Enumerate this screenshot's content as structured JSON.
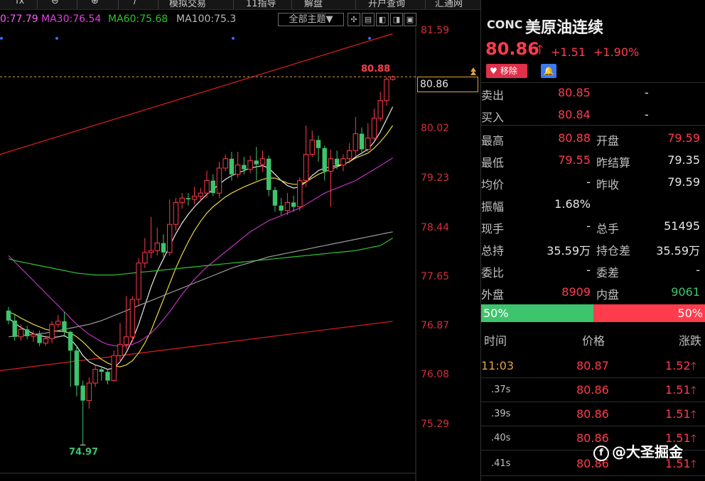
{
  "toolbar": {
    "items": [
      "fx",
      "⊖",
      "⊕",
      "/",
      "模拟交易",
      "11指导",
      "解盘",
      "开户查询",
      "汇通网"
    ]
  },
  "ma_legend": [
    {
      "label": "0:77.79",
      "color": "#ff5cff"
    },
    {
      "label": "MA30:76.54",
      "color": "#e040e0"
    },
    {
      "label": "MA60:75.68",
      "color": "#2fc22f"
    },
    {
      "label": "MA100:75.3",
      "color": "#b8b8b8"
    }
  ],
  "topic_button": "全部主题▼",
  "y_ticks": [
    "81.59",
    "80.02",
    "79.23",
    "78.44",
    "77.65",
    "76.87",
    "76.08",
    "75.29"
  ],
  "high_label": "80.88",
  "low_label": "74.97",
  "current_price_box": "80.86",
  "colors": {
    "up": "#ff3c4c",
    "down": "#3ec46d",
    "bg": "#000000",
    "accent": "#e1a43c"
  },
  "chart_data": {
    "type": "candlestick",
    "title": "",
    "ylim": [
      74.8,
      81.9
    ],
    "y_ticks": [
      81.59,
      80.02,
      79.23,
      78.44,
      77.65,
      76.87,
      76.08,
      75.29
    ],
    "current_price": 80.86,
    "high": 80.88,
    "low": 74.97,
    "candles": [
      [
        77.12,
        76.96,
        77.18,
        76.9
      ],
      [
        76.96,
        76.7,
        77.05,
        76.64
      ],
      [
        76.7,
        76.82,
        76.9,
        76.64
      ],
      [
        76.82,
        76.71,
        76.88,
        76.66
      ],
      [
        76.71,
        76.74,
        76.8,
        76.62
      ],
      [
        76.74,
        76.6,
        76.8,
        76.55
      ],
      [
        76.6,
        76.67,
        76.72,
        76.56
      ],
      [
        76.67,
        76.9,
        76.95,
        76.6
      ],
      [
        76.9,
        76.95,
        77.05,
        76.85
      ],
      [
        76.95,
        76.78,
        77.1,
        76.7
      ],
      [
        76.78,
        76.48,
        76.8,
        75.9
      ],
      [
        76.48,
        75.92,
        76.55,
        75.75
      ],
      [
        75.92,
        75.68,
        76.0,
        74.97
      ],
      [
        75.68,
        75.96,
        76.05,
        75.55
      ],
      [
        75.96,
        76.18,
        76.25,
        75.9
      ],
      [
        76.18,
        76.14,
        76.22,
        76.0
      ],
      [
        76.14,
        76.0,
        76.18,
        75.94
      ],
      [
        76.0,
        76.4,
        76.48,
        75.98
      ],
      [
        76.4,
        76.58,
        76.92,
        76.3
      ],
      [
        76.58,
        76.7,
        77.35,
        76.5
      ],
      [
        76.7,
        77.3,
        77.35,
        76.62
      ],
      [
        77.3,
        77.88,
        77.96,
        77.2
      ],
      [
        77.88,
        78.05,
        78.28,
        77.8
      ],
      [
        78.05,
        78.08,
        78.62,
        77.96
      ],
      [
        78.08,
        78.2,
        78.45,
        78.0
      ],
      [
        78.2,
        78.05,
        78.34,
        77.98
      ],
      [
        78.05,
        78.5,
        78.9,
        78.0
      ],
      [
        78.5,
        78.85,
        78.92,
        78.4
      ],
      [
        78.85,
        78.92,
        79.0,
        78.75
      ],
      [
        78.92,
        78.9,
        79.0,
        78.8
      ],
      [
        78.9,
        78.95,
        79.1,
        78.82
      ],
      [
        78.95,
        79.0,
        79.08,
        78.88
      ],
      [
        79.0,
        79.2,
        79.36,
        78.92
      ],
      [
        79.2,
        79.0,
        79.3,
        78.95
      ],
      [
        79.0,
        79.4,
        79.5,
        78.92
      ],
      [
        79.4,
        79.55,
        79.62,
        79.35
      ],
      [
        79.55,
        79.3,
        79.66,
        79.2
      ],
      [
        79.3,
        79.45,
        79.66,
        79.25
      ],
      [
        79.45,
        79.38,
        79.58,
        79.3
      ],
      [
        79.38,
        79.52,
        79.6,
        79.32
      ],
      [
        79.52,
        79.46,
        79.74,
        79.2
      ],
      [
        79.46,
        79.55,
        79.68,
        79.34
      ],
      [
        79.55,
        79.05,
        79.6,
        78.95
      ],
      [
        79.05,
        78.8,
        79.1,
        78.7
      ],
      [
        78.8,
        78.72,
        78.92,
        78.65
      ],
      [
        78.72,
        78.85,
        79.0,
        78.65
      ],
      [
        78.85,
        78.78,
        78.96,
        78.7
      ],
      [
        78.78,
        79.2,
        79.25,
        78.72
      ],
      [
        79.2,
        79.62,
        80.08,
        79.1
      ],
      [
        79.62,
        79.85,
        80.0,
        79.58
      ],
      [
        79.85,
        79.72,
        79.92,
        79.5
      ],
      [
        79.72,
        79.35,
        79.76,
        79.2
      ],
      [
        79.35,
        79.55,
        79.7,
        78.78
      ],
      [
        79.55,
        79.45,
        79.68,
        79.38
      ],
      [
        79.45,
        79.55,
        79.62,
        79.35
      ],
      [
        79.55,
        79.68,
        79.8,
        79.48
      ],
      [
        79.68,
        79.95,
        80.22,
        79.6
      ],
      [
        79.95,
        79.7,
        80.05,
        79.62
      ],
      [
        79.7,
        79.88,
        80.12,
        79.66
      ],
      [
        79.88,
        80.2,
        80.35,
        79.85
      ],
      [
        80.2,
        80.48,
        80.62,
        80.15
      ],
      [
        80.48,
        80.82,
        80.86,
        80.4
      ],
      [
        80.82,
        80.86,
        80.88,
        80.8
      ]
    ],
    "overlays": [
      {
        "name": "channel-upper",
        "color": "#e02020",
        "points": [
          [
            -2,
            79.6
          ],
          [
            62,
            81.55
          ]
        ]
      },
      {
        "name": "channel-lower",
        "color": "#e02020",
        "points": [
          [
            -2,
            76.15
          ],
          [
            62,
            76.95
          ]
        ]
      },
      {
        "name": "ma-white",
        "color": "#e8e8e8",
        "values": [
          77.0,
          76.92,
          76.85,
          76.8,
          76.75,
          76.72,
          76.7,
          76.69,
          76.7,
          76.72,
          76.66,
          76.55,
          76.4,
          76.3,
          76.25,
          76.22,
          76.18,
          76.2,
          76.3,
          76.45,
          76.65,
          76.9,
          77.2,
          77.5,
          77.75,
          77.95,
          78.15,
          78.35,
          78.52,
          78.66,
          78.78,
          78.88,
          78.98,
          79.06,
          79.14,
          79.22,
          79.28,
          79.32,
          79.36,
          79.4,
          79.42,
          79.44,
          79.4,
          79.3,
          79.2,
          79.12,
          79.08,
          79.1,
          79.18,
          79.28,
          79.36,
          79.4,
          79.42,
          79.44,
          79.46,
          79.5,
          79.58,
          79.64,
          79.7,
          79.82,
          79.98,
          80.18,
          80.38
        ]
      },
      {
        "name": "ma-yellow",
        "color": "#e8d83a",
        "values": [
          77.1,
          77.06,
          77.0,
          76.95,
          76.9,
          76.86,
          76.82,
          76.8,
          76.79,
          76.78,
          76.76,
          76.7,
          76.62,
          76.52,
          76.42,
          76.34,
          76.28,
          76.24,
          76.22,
          76.25,
          76.32,
          76.44,
          76.6,
          76.8,
          77.05,
          77.3,
          77.55,
          77.8,
          78.02,
          78.22,
          78.4,
          78.55,
          78.68,
          78.78,
          78.86,
          78.94,
          79.0,
          79.05,
          79.1,
          79.14,
          79.18,
          79.22,
          79.24,
          79.24,
          79.2,
          79.16,
          79.14,
          79.14,
          79.18,
          79.24,
          79.3,
          79.34,
          79.38,
          79.42,
          79.46,
          79.5,
          79.56,
          79.6,
          79.64,
          79.72,
          79.82,
          79.94,
          80.08
        ]
      },
      {
        "name": "ma30",
        "color": "#c030c0",
        "values": [
          78.0,
          77.9,
          77.8,
          77.7,
          77.6,
          77.5,
          77.4,
          77.3,
          77.2,
          77.1,
          77.0,
          76.9,
          76.82,
          76.74,
          76.68,
          76.62,
          76.58,
          76.56,
          76.55,
          76.56,
          76.58,
          76.62,
          76.68,
          76.76,
          76.86,
          76.98,
          77.1,
          77.24,
          77.38,
          77.5,
          77.62,
          77.72,
          77.82,
          77.9,
          77.98,
          78.06,
          78.14,
          78.22,
          78.3,
          78.38,
          78.44,
          78.5,
          78.56,
          78.6,
          78.64,
          78.68,
          78.72,
          78.76,
          78.82,
          78.88,
          78.94,
          79.0,
          79.04,
          79.08,
          79.12,
          79.16,
          79.2,
          79.26,
          79.32,
          79.38,
          79.44,
          79.5,
          79.56
        ]
      },
      {
        "name": "ma60",
        "color": "#2fc22f",
        "values": [
          77.95,
          77.92,
          77.9,
          77.88,
          77.86,
          77.84,
          77.82,
          77.8,
          77.78,
          77.76,
          77.74,
          77.72,
          77.71,
          77.7,
          77.69,
          77.69,
          77.69,
          77.69,
          77.7,
          77.71,
          77.72,
          77.73,
          77.74,
          77.75,
          77.76,
          77.77,
          77.78,
          77.79,
          77.8,
          77.81,
          77.82,
          77.83,
          77.84,
          77.85,
          77.86,
          77.87,
          77.88,
          77.89,
          77.9,
          77.91,
          77.92,
          77.93,
          77.94,
          77.95,
          77.96,
          77.97,
          77.98,
          77.99,
          78.0,
          78.01,
          78.02,
          78.03,
          78.04,
          78.05,
          78.06,
          78.07,
          78.08,
          78.1,
          78.12,
          78.14,
          78.16,
          78.22,
          78.28
        ]
      },
      {
        "name": "ma100",
        "color": "#9a9a9a",
        "values": [
          76.7,
          76.71,
          76.72,
          76.73,
          76.74,
          76.75,
          76.76,
          76.78,
          76.8,
          76.82,
          76.84,
          76.86,
          76.88,
          76.9,
          76.93,
          76.96,
          77.0,
          77.04,
          77.08,
          77.12,
          77.16,
          77.2,
          77.24,
          77.28,
          77.32,
          77.36,
          77.4,
          77.44,
          77.48,
          77.52,
          77.56,
          77.6,
          77.64,
          77.68,
          77.72,
          77.76,
          77.8,
          77.83,
          77.86,
          77.89,
          77.92,
          77.95,
          77.98,
          78.0,
          78.02,
          78.04,
          78.06,
          78.08,
          78.1,
          78.12,
          78.14,
          78.16,
          78.18,
          78.2,
          78.22,
          78.24,
          78.26,
          78.28,
          78.3,
          78.32,
          78.34,
          78.36,
          78.38
        ]
      }
    ]
  },
  "quote": {
    "code": "CONC",
    "name": "美原油连续",
    "last": "80.86",
    "arrow": "🡑",
    "change": "+1.51",
    "change_pct": "+1.90%",
    "remove_label": "移除",
    "heart": "♥",
    "bell": "🔔",
    "ask_label": "卖出",
    "ask": "80.85",
    "ask_vol": "-",
    "bid_label": "买入",
    "bid": "80.84",
    "bid_vol": "-",
    "rows": [
      {
        "l1": "最高",
        "v1": "80.88",
        "c1": "red",
        "l2": "开盘",
        "v2": "79.59",
        "c2": "red"
      },
      {
        "l1": "最低",
        "v1": "79.55",
        "c1": "red",
        "l2": "昨结算",
        "v2": "79.35",
        "c2": "wht"
      },
      {
        "l1": "均价",
        "v1": "-",
        "c1": "wht",
        "l2": "昨收",
        "v2": "79.59",
        "c2": "wht"
      },
      {
        "l1": "振幅",
        "v1": "1.68%",
        "c1": "wht",
        "l2": "",
        "v2": "",
        "c2": "wht"
      },
      {
        "l1": "现手",
        "v1": "-",
        "c1": "wht",
        "l2": "总手",
        "v2": "51495",
        "c2": "wht"
      },
      {
        "l1": "总持",
        "v1": "35.59万",
        "c1": "wht",
        "l2": "持仓差",
        "v2": "35.59万",
        "c2": "wht"
      },
      {
        "l1": "委比",
        "v1": "-",
        "c1": "wht",
        "l2": "委差",
        "v2": "-",
        "c2": "wht"
      },
      {
        "l1": "外盘",
        "v1": "8909",
        "c1": "red",
        "l2": "内盘",
        "v2": "9061",
        "c2": "grn"
      }
    ],
    "buy_ratio": "50%",
    "sell_ratio": "50%",
    "buy_fraction": 0.5
  },
  "trades": {
    "headers": [
      "时间",
      "价格",
      "涨跌"
    ],
    "rows": [
      {
        "time": "11:03",
        "price": "80.87",
        "change": "1.52",
        "arrow": "🡑"
      },
      {
        "time": ".37s",
        "price": "80.86",
        "change": "1.51",
        "arrow": "🡑"
      },
      {
        "time": ".39s",
        "price": "80.86",
        "change": "1.51",
        "arrow": "🡑"
      },
      {
        "time": ".40s",
        "price": "80.86",
        "change": "1.51",
        "arrow": "🡑"
      },
      {
        "time": ".41s",
        "price": "80.86",
        "change": "1.51",
        "arrow": "🡑"
      }
    ]
  },
  "watermark": {
    "logo": "f",
    "text": "@大圣掘金"
  }
}
